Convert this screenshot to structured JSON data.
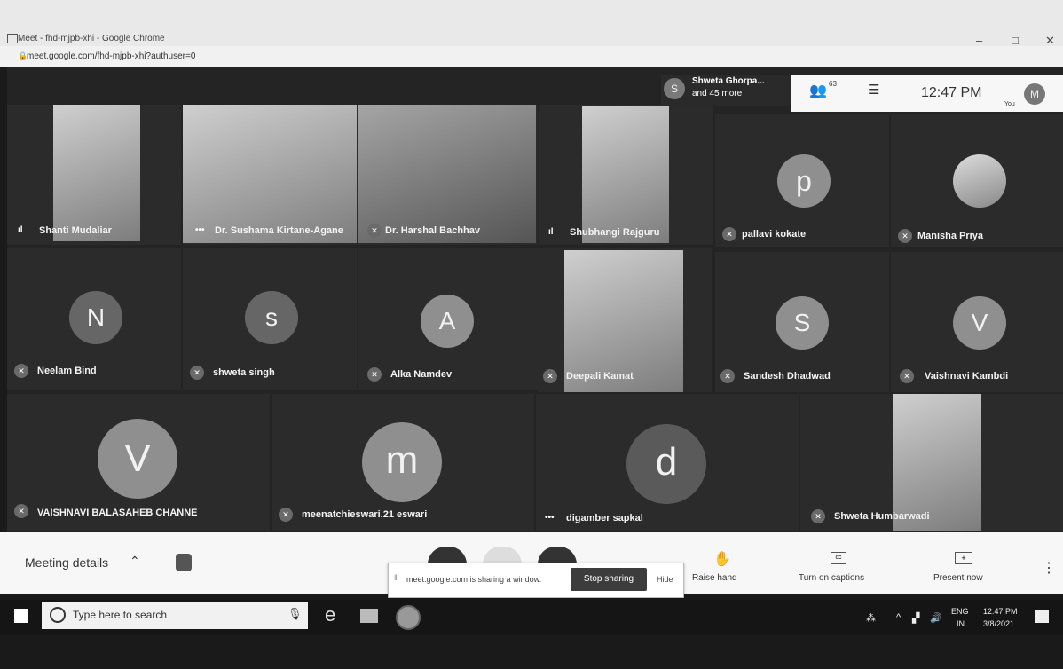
{
  "window": {
    "title": "Meet - fhd-mjpb-xhi - Google Chrome",
    "url": "meet.google.com/fhd-mjpb-xhi?authuser=0",
    "minimize": "–",
    "restore": "□",
    "close": "✕"
  },
  "presenter": {
    "initial": "S",
    "line1": "Shweta Ghorpa...",
    "line2": "and 45 more"
  },
  "topbar": {
    "people_count": "63",
    "time": "12:47 PM",
    "you_label": "You",
    "avatar_initial": "M"
  },
  "participants": [
    {
      "name": "Shanti Mudaliar",
      "type": "video",
      "status": "speaking"
    },
    {
      "name": "Dr. Sushama Kirtane-Agane",
      "type": "video",
      "status": "more"
    },
    {
      "name": "Dr. Harshal Bachhav",
      "type": "video",
      "status": "muted"
    },
    {
      "name": "Shubhangi Rajguru",
      "type": "video",
      "status": "speaking"
    },
    {
      "name": "pallavi kokate",
      "type": "avatar",
      "initial": "p",
      "status": "muted"
    },
    {
      "name": "Manisha Priya",
      "type": "photo",
      "status": "muted"
    },
    {
      "name": "Neelam Bind",
      "type": "avatar",
      "initial": "N",
      "status": "muted"
    },
    {
      "name": "shweta singh",
      "type": "avatar",
      "initial": "s",
      "status": "muted"
    },
    {
      "name": "Alka Namdev",
      "type": "avatar",
      "initial": "A",
      "status": "muted"
    },
    {
      "name": "Deepali Kamat",
      "type": "video",
      "status": "muted"
    },
    {
      "name": "Sandesh Dhadwad",
      "type": "avatar",
      "initial": "S",
      "status": "muted"
    },
    {
      "name": "Vaishnavi Kambdi",
      "type": "avatar",
      "initial": "V",
      "status": "muted"
    },
    {
      "name": "VAISHNAVI BALASAHEB CHANNE",
      "type": "avatar",
      "initial": "V",
      "status": "muted"
    },
    {
      "name": "meenatchieswari.21 eswari",
      "type": "avatar",
      "initial": "m",
      "status": "muted"
    },
    {
      "name": "digamber sapkal",
      "type": "avatar",
      "initial": "d",
      "status": "more"
    },
    {
      "name": "Shweta Humbarwadi",
      "type": "video",
      "status": "muted"
    }
  ],
  "bottom": {
    "meeting_details": "Meeting details",
    "raise_hand": "Raise hand",
    "captions": "Turn on captions",
    "present": "Present now",
    "more": "⋮"
  },
  "share_banner": {
    "text": "meet.google.com is sharing a window.",
    "stop": "Stop sharing",
    "hide": "Hide"
  },
  "taskbar": {
    "search_placeholder": "Type here to search",
    "lang1": "ENG",
    "lang2": "IN",
    "time": "12:47 PM",
    "date": "3/8/2021"
  },
  "colors": {
    "tile_bg": "#2b2b2b",
    "avatar_bg": "#8f8f8f",
    "stop_btn": "#3c3c3c"
  }
}
